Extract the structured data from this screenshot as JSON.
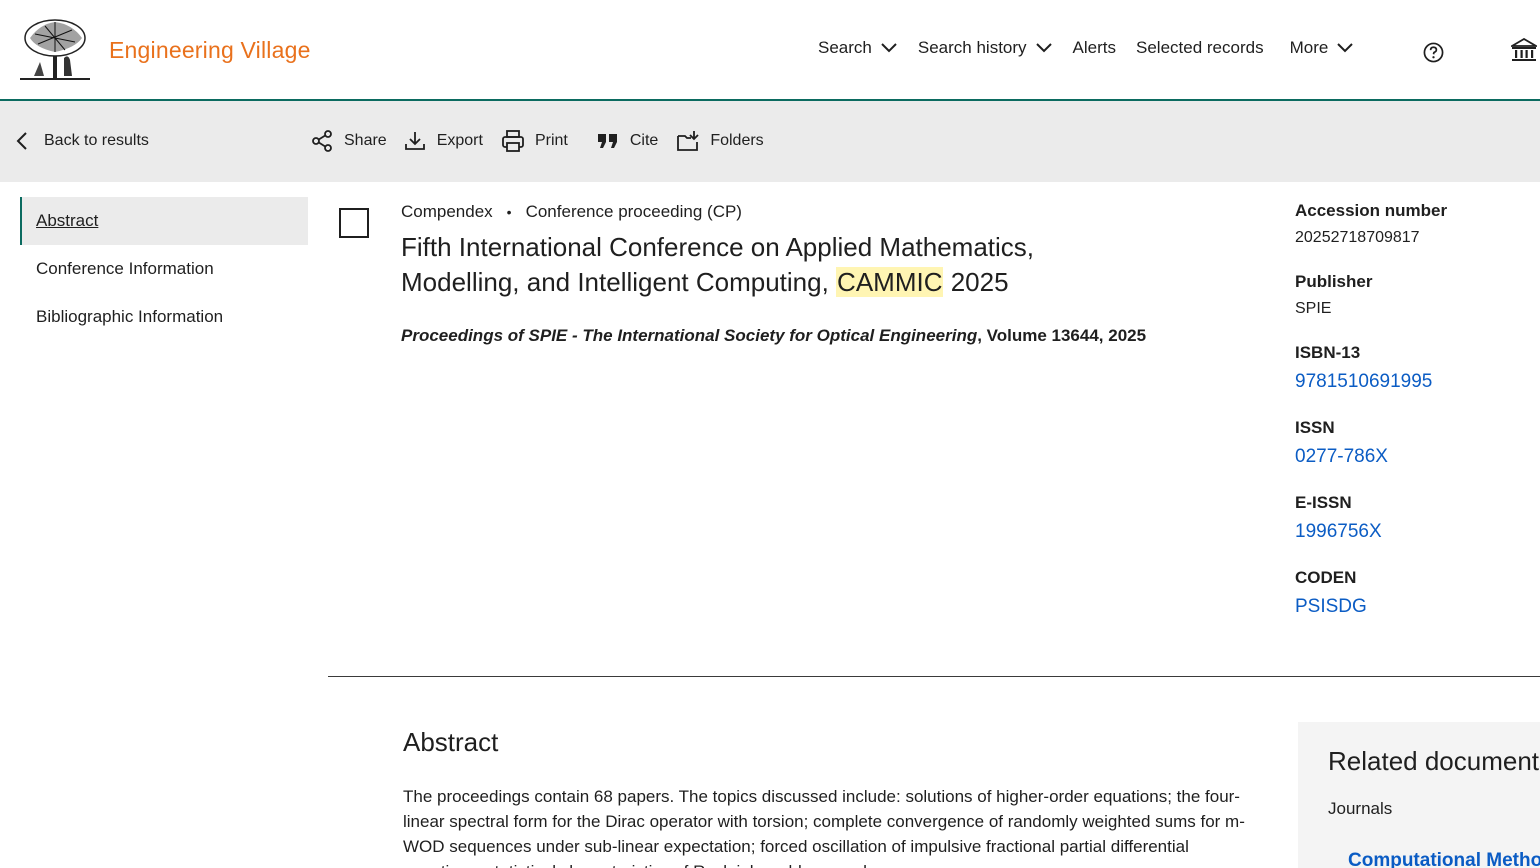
{
  "header": {
    "brand": "Engineering Village",
    "nav": [
      {
        "label": "Search",
        "dropdown": true
      },
      {
        "label": "Search history",
        "dropdown": true
      },
      {
        "label": "Alerts",
        "dropdown": false
      },
      {
        "label": "Selected records",
        "dropdown": false
      },
      {
        "label": "More",
        "dropdown": true
      }
    ],
    "icons": [
      "help-icon",
      "institution-icon"
    ],
    "accent_color": "#e9711c",
    "rule_color": "#0b6b60"
  },
  "toolbar": {
    "back_label": "Back to results",
    "share_label": "Share",
    "export_label": "Export",
    "print_label": "Print",
    "cite_label": "Cite",
    "folders_label": "Folders"
  },
  "sidebar": {
    "items": [
      {
        "label": "Abstract",
        "active": true
      },
      {
        "label": "Conference Information",
        "active": false
      },
      {
        "label": "Bibliographic Information",
        "active": false
      }
    ]
  },
  "record": {
    "database": "Compendex",
    "doc_type": "Conference proceeding (CP)",
    "title_before": "Fifth International Conference on Applied Mathematics, Modelling, and Intelligent Computing, ",
    "title_highlight": "CAMMIC",
    "title_after": " 2025",
    "source_journal": "Proceedings of SPIE - The International Society for Optical Engineering",
    "source_rest": ", Volume 13644, 2025"
  },
  "info": {
    "accession_label": "Accession number",
    "accession_value": "20252718709817",
    "publisher_label": "Publisher",
    "publisher_value": "SPIE",
    "isbn_label": "ISBN-13",
    "isbn_value": "9781510691995",
    "issn_label": "ISSN",
    "issn_value": "0277-786X",
    "eissn_label": "E-ISSN",
    "eissn_value": "1996756X",
    "coden_label": "CODEN",
    "coden_value": "PSISDG"
  },
  "abstract": {
    "heading": "Abstract",
    "text": "The proceedings contain 68 papers. The topics discussed include: solutions of higher-order equations; the four-linear spectral form for the Dirac operator with torsion; complete convergence of randomly weighted sums for m-WOD sequences under sub-linear expectation; forced oscillation of impulsive fractional partial differential equations; statistical characteristics of Rayleigh problems and"
  },
  "related": {
    "heading": "Related documents",
    "subheading": "Journals",
    "first_link": "Computational Methods"
  }
}
